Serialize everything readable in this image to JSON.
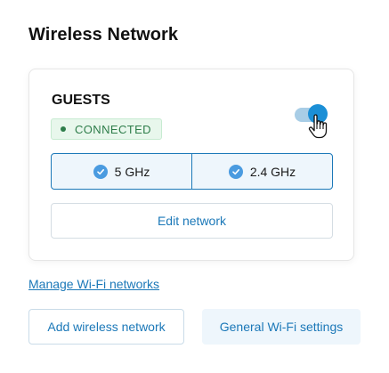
{
  "section": {
    "title": "Wireless Network"
  },
  "network": {
    "name": "GUESTS",
    "status": "CONNECTED",
    "enabled": true,
    "bands": [
      {
        "label": "5 GHz",
        "checked": true
      },
      {
        "label": "2.4 GHz",
        "checked": true
      }
    ],
    "edit_label": "Edit network"
  },
  "links": {
    "manage": "Manage Wi-Fi networks"
  },
  "actions": {
    "add": "Add wireless network",
    "settings": "General Wi-Fi settings"
  },
  "colors": {
    "accent": "#1b78b8",
    "toggle_on": "#1b8fd6",
    "status_green": "#2e7d4a",
    "status_bg": "#e8f7ec"
  },
  "icons": {
    "status": "status-dot-icon",
    "band_check": "check-circle-icon",
    "cursor": "hand-pointer-icon"
  }
}
